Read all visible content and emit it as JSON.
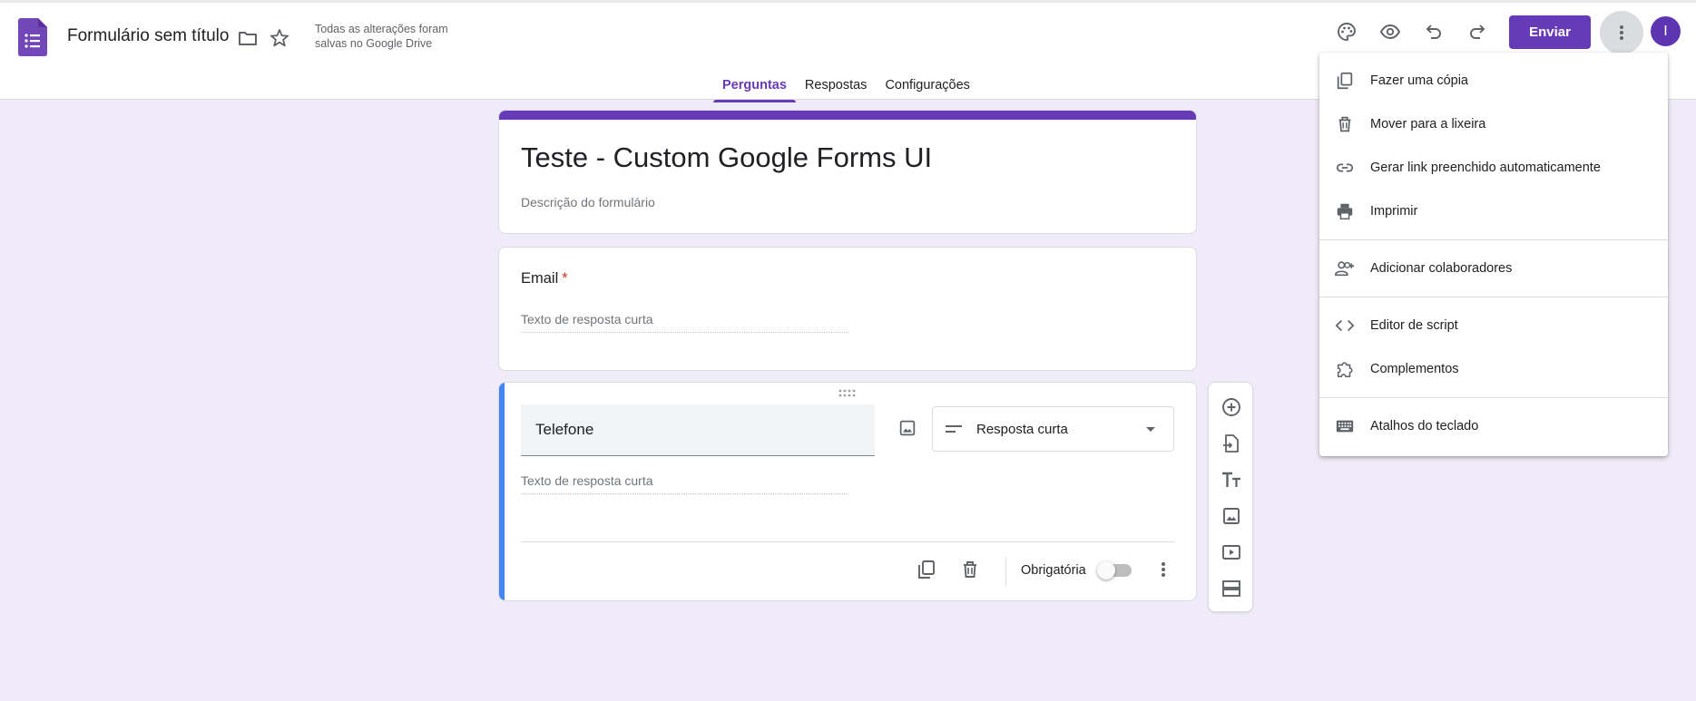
{
  "header": {
    "doc_title": "Formulário sem título",
    "save_status": "Todas as alterações foram salvas no Google Drive",
    "send_label": "Enviar",
    "avatar_initial": "I"
  },
  "tabs": [
    {
      "label": "Perguntas",
      "active": true
    },
    {
      "label": "Respostas",
      "active": false
    },
    {
      "label": "Configurações",
      "active": false
    }
  ],
  "form": {
    "title": "Teste - Custom Google Forms UI",
    "description_placeholder": "Descrição do formulário"
  },
  "questions": [
    {
      "label": "Email",
      "required_mark": "*",
      "answer_placeholder": "Texto de resposta curta"
    },
    {
      "title": "Telefone",
      "answer_placeholder": "Texto de resposta curta",
      "type_label": "Resposta curta",
      "required_label": "Obrigatória",
      "required": false
    }
  ],
  "menu": {
    "items": [
      {
        "label": "Fazer uma cópia",
        "icon": "copy-icon"
      },
      {
        "label": "Mover para a lixeira",
        "icon": "trash-icon"
      },
      {
        "label": "Gerar link preenchido automaticamente",
        "icon": "link-icon"
      },
      {
        "label": "Imprimir",
        "icon": "print-icon"
      },
      {
        "label": "Adicionar colaboradores",
        "icon": "add-people-icon"
      },
      {
        "label": "Editor de script",
        "icon": "code-icon"
      },
      {
        "label": "Complementos",
        "icon": "puzzle-icon"
      },
      {
        "label": "Atalhos do teclado",
        "icon": "keyboard-icon"
      }
    ]
  },
  "colors": {
    "accent": "#673ab7",
    "background": "#f0ebf8",
    "active_question": "#4285f4",
    "required": "#d93025"
  }
}
